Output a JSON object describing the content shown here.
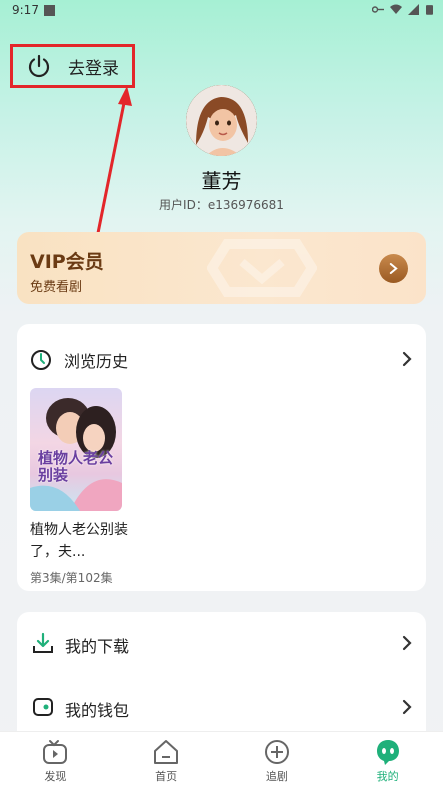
{
  "status_bar": {
    "time": "9:17"
  },
  "header": {
    "login_label": "去登录"
  },
  "profile": {
    "name": "董芳",
    "user_id": "用户ID：e136976681"
  },
  "vip": {
    "title": "VIP会员",
    "subtitle": "免费看剧"
  },
  "history": {
    "title": "浏览历史",
    "items": [
      {
        "poster_text": "植物人老公别装",
        "title": "植物人老公别装了，夫...",
        "episode": "第3集/第102集"
      }
    ]
  },
  "menu": {
    "items": [
      {
        "label": "我的下载"
      },
      {
        "label": "我的钱包"
      }
    ]
  },
  "tabs": [
    {
      "label": "发现"
    },
    {
      "label": "首页"
    },
    {
      "label": "追剧"
    },
    {
      "label": "我的"
    }
  ],
  "colors": {
    "accent": "#1fb07a",
    "highlight": "#e3262a",
    "vip_text": "#6b3b14"
  }
}
